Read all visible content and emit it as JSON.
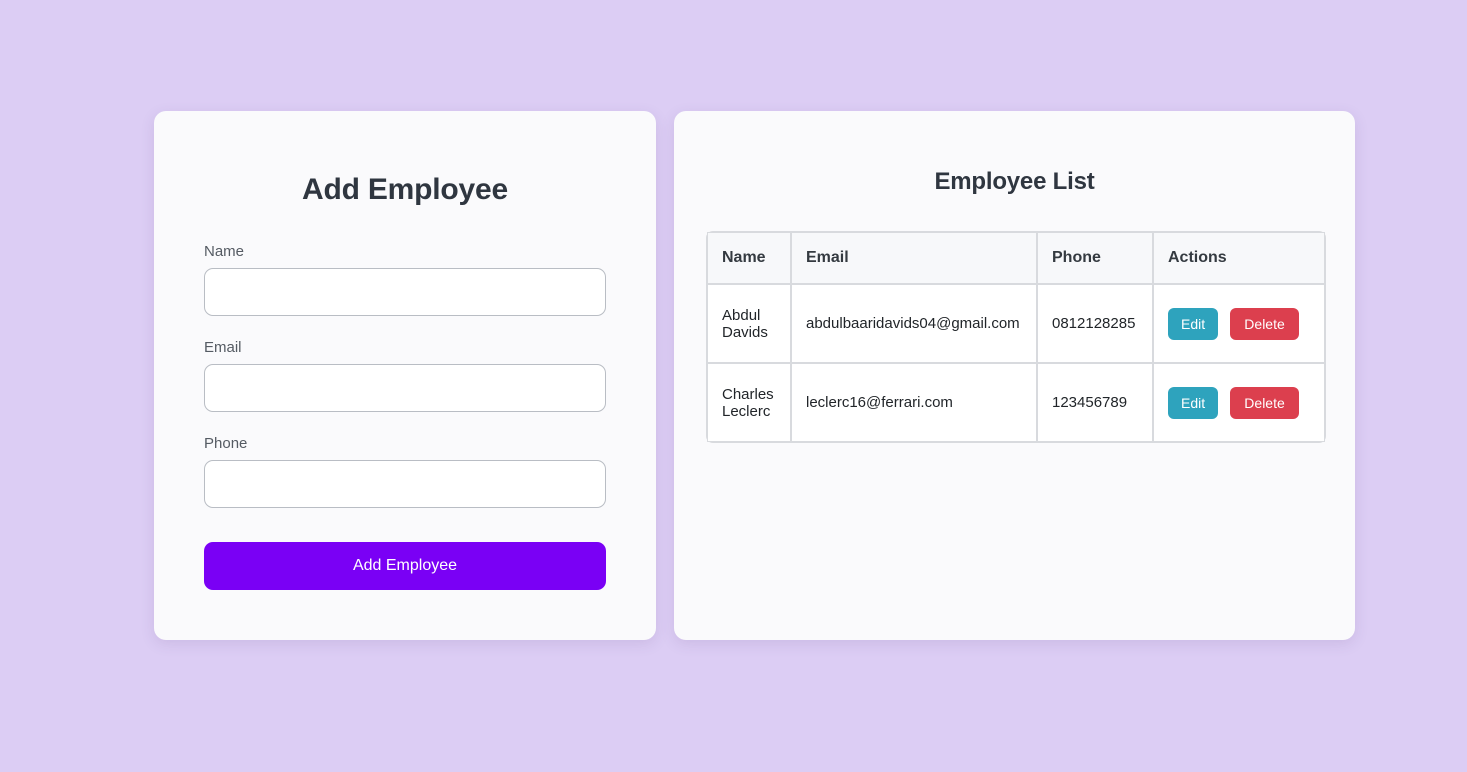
{
  "page": {
    "background_color": "#dccdf4"
  },
  "form_panel": {
    "title": "Add Employee",
    "fields": [
      {
        "label": "Name",
        "value": "",
        "placeholder": ""
      },
      {
        "label": "Email",
        "value": "",
        "placeholder": ""
      },
      {
        "label": "Phone",
        "value": "",
        "placeholder": ""
      }
    ],
    "submit_label": "Add Employee",
    "submit_color": "#7a00f5"
  },
  "list_panel": {
    "title": "Employee List",
    "columns": [
      "Name",
      "Email",
      "Phone",
      "Actions"
    ],
    "rows": [
      {
        "name": "Abdul Davids",
        "email": "abdulbaaridavids04@gmail.com",
        "phone": "0812128285",
        "edit_label": "Edit",
        "delete_label": "Delete"
      },
      {
        "name": "Charles Leclerc",
        "email": "leclerc16@ferrari.com",
        "phone": "123456789",
        "edit_label": "Edit",
        "delete_label": "Delete"
      }
    ],
    "edit_color": "#2ea3bd",
    "delete_color": "#dc3f4e"
  }
}
